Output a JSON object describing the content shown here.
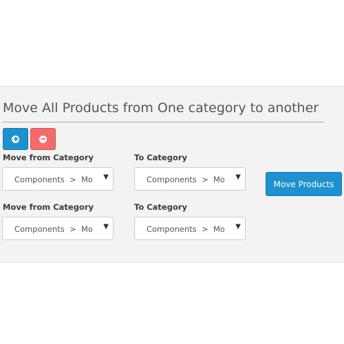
{
  "page": {
    "title": "Move All Products from One category to another"
  },
  "toolbar": {
    "add_icon": "plus-circle-icon",
    "remove_icon": "minus-circle-icon"
  },
  "rows": [
    {
      "from_label": "Move from Category",
      "from_value": "Components  >  Monitors",
      "to_label": "To Category",
      "to_value": "Components  >  Monitors"
    },
    {
      "from_label": "Move from Category",
      "from_value": "Components  >  Monitors",
      "to_label": "To Category",
      "to_value": "Components  >  Monitors"
    }
  ],
  "actions": {
    "move_label": "Move Products"
  },
  "colors": {
    "primary": "#1e91cf",
    "danger": "#f56b6b",
    "panel_background": "#f3f3f3"
  }
}
